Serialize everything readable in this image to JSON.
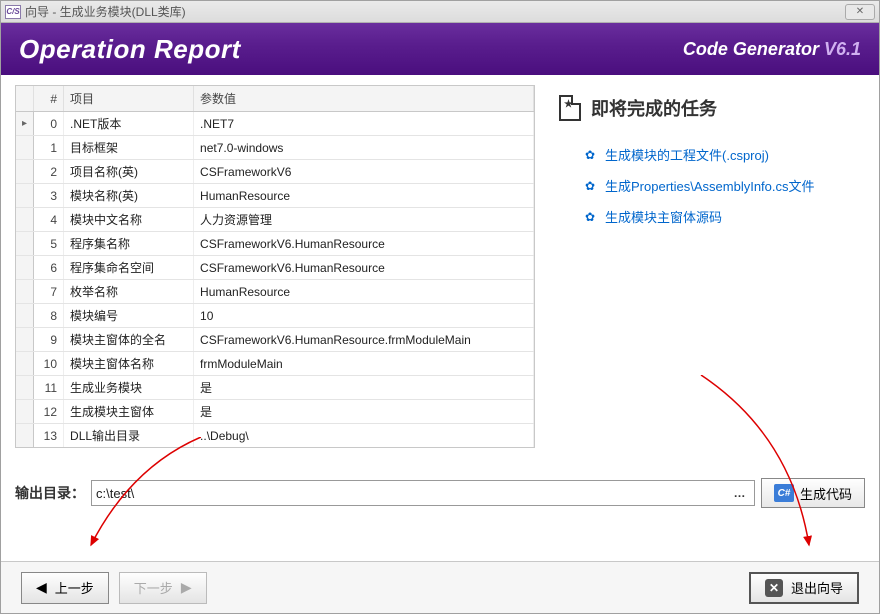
{
  "window": {
    "icon_text": "C/S",
    "title": "向导 - 生成业务模块(DLL类库)"
  },
  "header": {
    "title": "Operation Report",
    "brand": "Code Generator",
    "version": "V6.1"
  },
  "table": {
    "col_num": "#",
    "col_key": "项目",
    "col_val": "参数值",
    "rows": [
      {
        "n": "0",
        "key": ".NET版本",
        "val": ".NET7"
      },
      {
        "n": "1",
        "key": "目标框架",
        "val": "net7.0-windows"
      },
      {
        "n": "2",
        "key": "项目名称(英)",
        "val": "CSFrameworkV6"
      },
      {
        "n": "3",
        "key": "模块名称(英)",
        "val": "HumanResource"
      },
      {
        "n": "4",
        "key": "模块中文名称",
        "val": "人力资源管理"
      },
      {
        "n": "5",
        "key": "程序集名称",
        "val": "CSFrameworkV6.HumanResource"
      },
      {
        "n": "6",
        "key": "程序集命名空间",
        "val": "CSFrameworkV6.HumanResource"
      },
      {
        "n": "7",
        "key": "枚举名称",
        "val": "HumanResource"
      },
      {
        "n": "8",
        "key": "模块编号",
        "val": "10"
      },
      {
        "n": "9",
        "key": "模块主窗体的全名",
        "val": "CSFrameworkV6.HumanResource.frmModuleMain"
      },
      {
        "n": "10",
        "key": "模块主窗体名称",
        "val": "frmModuleMain"
      },
      {
        "n": "11",
        "key": "生成业务模块",
        "val": "是"
      },
      {
        "n": "12",
        "key": "生成模块主窗体",
        "val": "是"
      },
      {
        "n": "13",
        "key": "DLL输出目录",
        "val": "..\\Debug\\"
      }
    ]
  },
  "right": {
    "title": "即将完成的任务",
    "tasks": [
      "生成模块的工程文件(.csproj)",
      "生成Properties\\AssemblyInfo.cs文件",
      "生成模块主窗体源码"
    ]
  },
  "output": {
    "label": "输出目录：",
    "value": "c:\\test\\",
    "browse": "…",
    "gen_icon": "C#",
    "gen_label": "生成代码"
  },
  "footer": {
    "prev": "上一步",
    "next": "下一步",
    "exit": "退出向导"
  }
}
